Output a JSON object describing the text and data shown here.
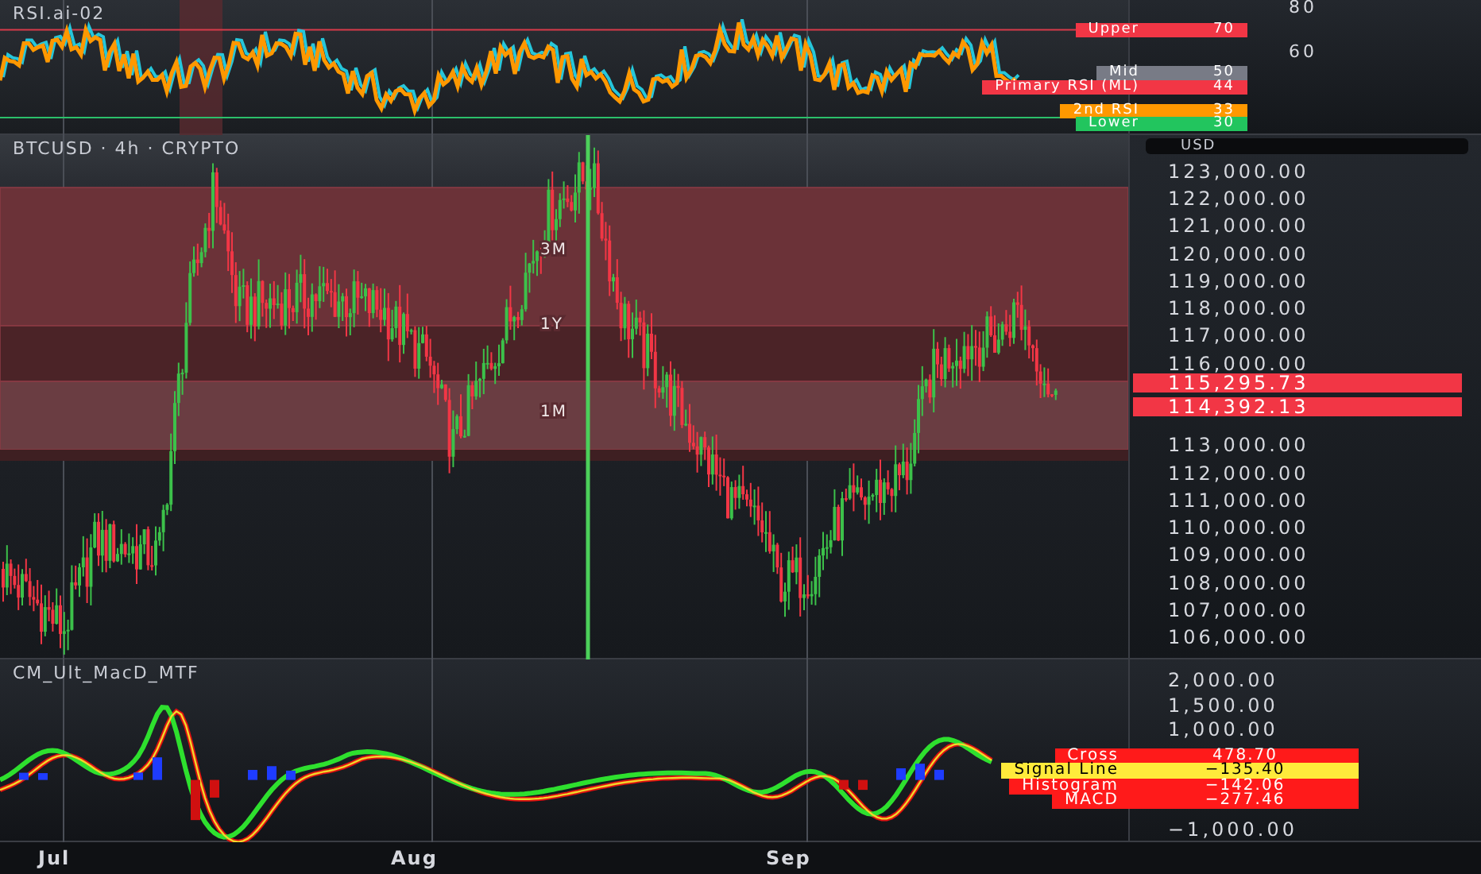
{
  "rsi": {
    "title": "RSI.ai-02",
    "ticks": [
      "80",
      "60"
    ],
    "tags": [
      {
        "label": "Upper",
        "value": "70",
        "color": "#f23645"
      },
      {
        "label": "Mid",
        "value": "50",
        "color": "#787b86"
      },
      {
        "label": "Primary RSI (ML)",
        "value": "44",
        "color": "#f23645"
      },
      {
        "label": "2nd RSI",
        "value": "33",
        "color": "#ff9800"
      },
      {
        "label": "Lower",
        "value": "30",
        "color": "#22c55e"
      }
    ]
  },
  "price_chart": {
    "title": "BTCUSD · 4h · CRYPTO",
    "currency": "USD",
    "zones": [
      {
        "label": "3M"
      },
      {
        "label": "1Y"
      },
      {
        "label": "1M"
      }
    ],
    "ticks": [
      "123,000.00",
      "122,000.00",
      "121,000.00",
      "120,000.00",
      "119,000.00",
      "118,000.00",
      "117,000.00",
      "116,000.00",
      "113,000.00",
      "112,000.00",
      "111,000.00",
      "110,000.00",
      "109,000.00",
      "108,000.00",
      "107,000.00",
      "106,000.00"
    ],
    "price_tags": [
      "115,295.73",
      "114,392.13"
    ]
  },
  "macd": {
    "title": "CM_Ult_MacD_MTF",
    "ticks": [
      "2,000.00",
      "1,500.00",
      "1,000.00",
      "−1,000.00"
    ],
    "tags": [
      {
        "label": "Cross",
        "value": "478.70",
        "color": "#ff1a1a"
      },
      {
        "label": "Signal Line",
        "value": "−135.40",
        "color": "#ffeb3b"
      },
      {
        "label": "Histogram",
        "value": "−142.06",
        "color": "#ff1a1a"
      },
      {
        "label": "MACD",
        "value": "−277.46",
        "color": "#ff1a1a"
      }
    ]
  },
  "time_axis": [
    "Jul",
    "Aug",
    "Sep"
  ]
}
